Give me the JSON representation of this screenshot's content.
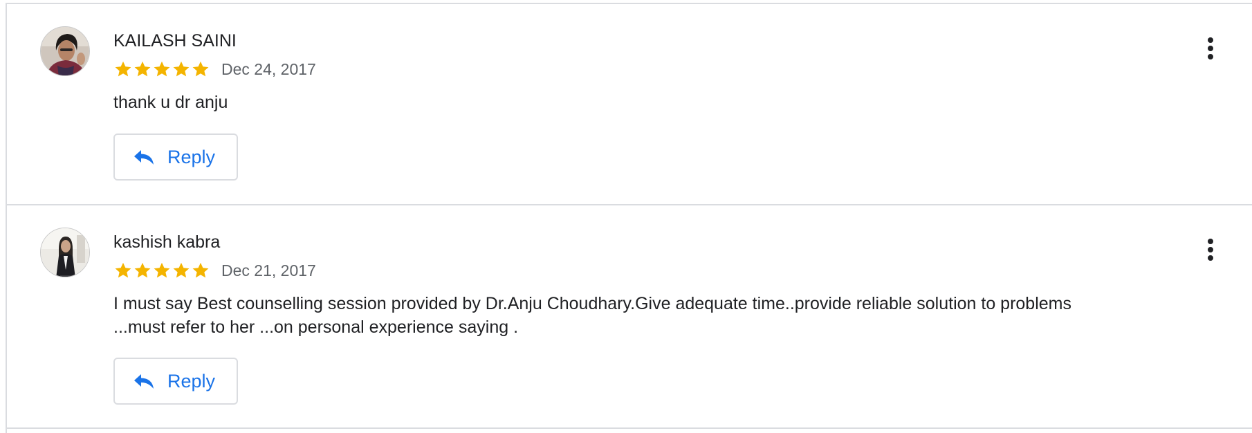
{
  "reviews": [
    {
      "reviewer": "KAILASH SAINI",
      "rating": 5,
      "date": "Dec 24, 2017",
      "text": "thank u dr anju",
      "reply_label": "Reply",
      "more_icon": "more-vert-icon"
    },
    {
      "reviewer": "kashish kabra",
      "rating": 5,
      "date": "Dec 21, 2017",
      "text": "I must say Best counselling session provided by Dr.Anju Choudhary.Give adequate time..provide reliable solution to problems ...must refer to her ...on personal experience saying .",
      "reply_label": "Reply",
      "more_icon": "more-vert-icon"
    }
  ],
  "colors": {
    "star": "#f4b400",
    "reply_text": "#1a73e8",
    "divider": "#dadce0",
    "secondary_text": "#5f6368"
  },
  "icons": {
    "star": "star-icon",
    "reply": "reply-arrow-icon",
    "more": "more-vert-icon"
  }
}
